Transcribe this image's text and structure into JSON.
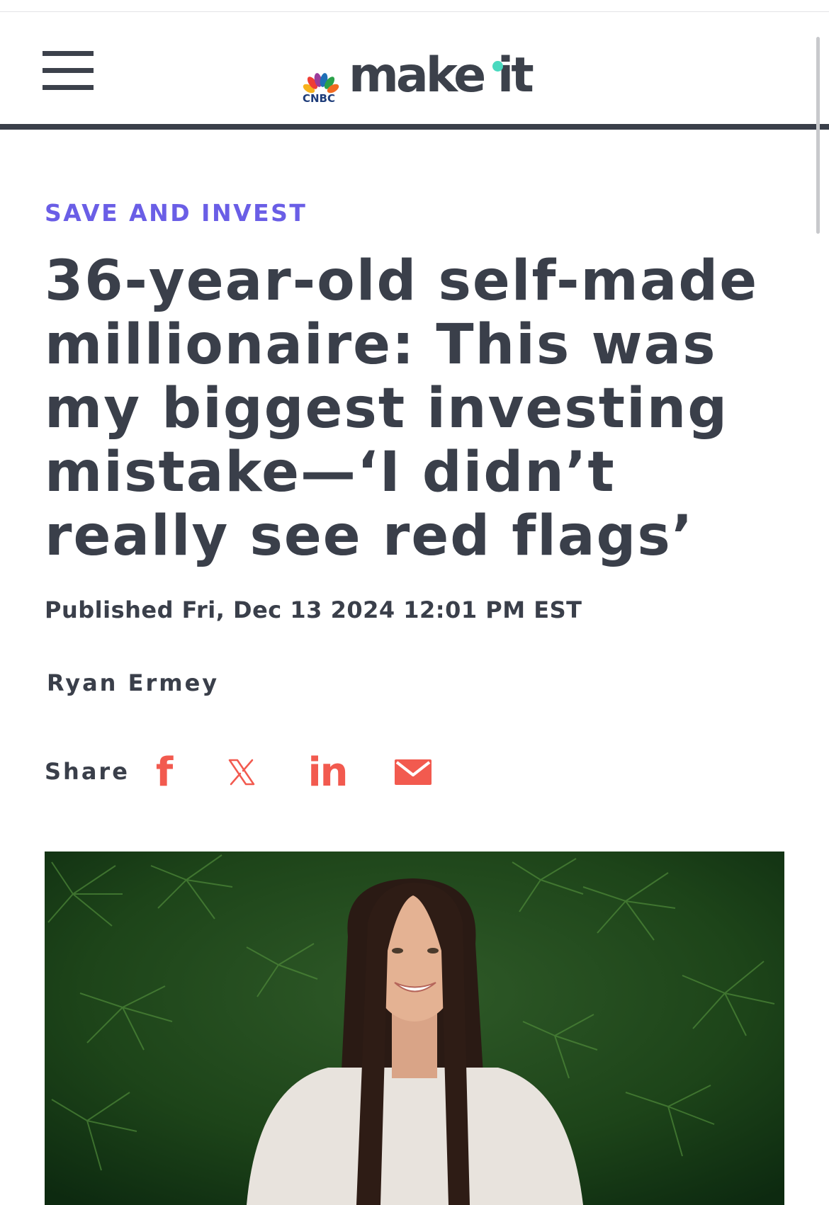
{
  "header": {
    "brand_network": "CNBC",
    "brand_name": "make it",
    "colors": {
      "text": "#3c414b",
      "accent_dot": "#49d9bf"
    }
  },
  "article": {
    "category": "SAVE AND INVEST",
    "headline": "36-year-old self-made millionaire: This was my biggest investing mistake—‘I didn’t really see red flags’",
    "published": "Published Fri, Dec 13 2024 12:01 PM EST",
    "author": "Ryan Ermey"
  },
  "share": {
    "label": "Share",
    "facebook_glyph": "f",
    "linkedin_glyph": "in",
    "icons": [
      "facebook-icon",
      "x-icon",
      "linkedin-icon",
      "email-icon"
    ],
    "color": "#f25a4f"
  },
  "colors": {
    "category": "#6a5ee6",
    "body_text": "#3a3f4a"
  }
}
